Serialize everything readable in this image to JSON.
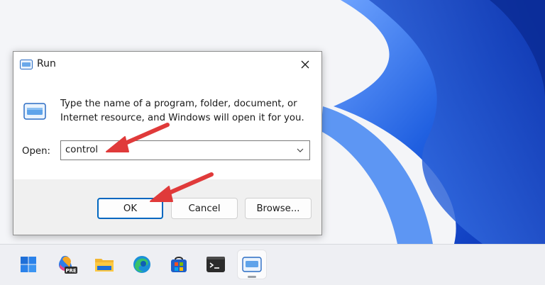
{
  "dialog": {
    "title": "Run",
    "description": "Type the name of a program, folder, document, or Internet resource, and Windows will open it for you.",
    "open_label": "Open:",
    "open_value": "control",
    "buttons": {
      "ok": "OK",
      "cancel": "Cancel",
      "browse": "Browse..."
    }
  },
  "taskbar": {
    "items": [
      {
        "icon": "windows-start-icon"
      },
      {
        "icon": "copilot-pre-icon",
        "badge": "PRE"
      },
      {
        "icon": "file-explorer-icon"
      },
      {
        "icon": "edge-browser-icon"
      },
      {
        "icon": "microsoft-store-icon"
      },
      {
        "icon": "terminal-icon"
      },
      {
        "icon": "run-app-icon",
        "active": true
      }
    ]
  },
  "colors": {
    "accent": "#0067c0",
    "annotation_arrow": "#e03a3a",
    "wallpaper_blue": "#1e5bd8"
  }
}
